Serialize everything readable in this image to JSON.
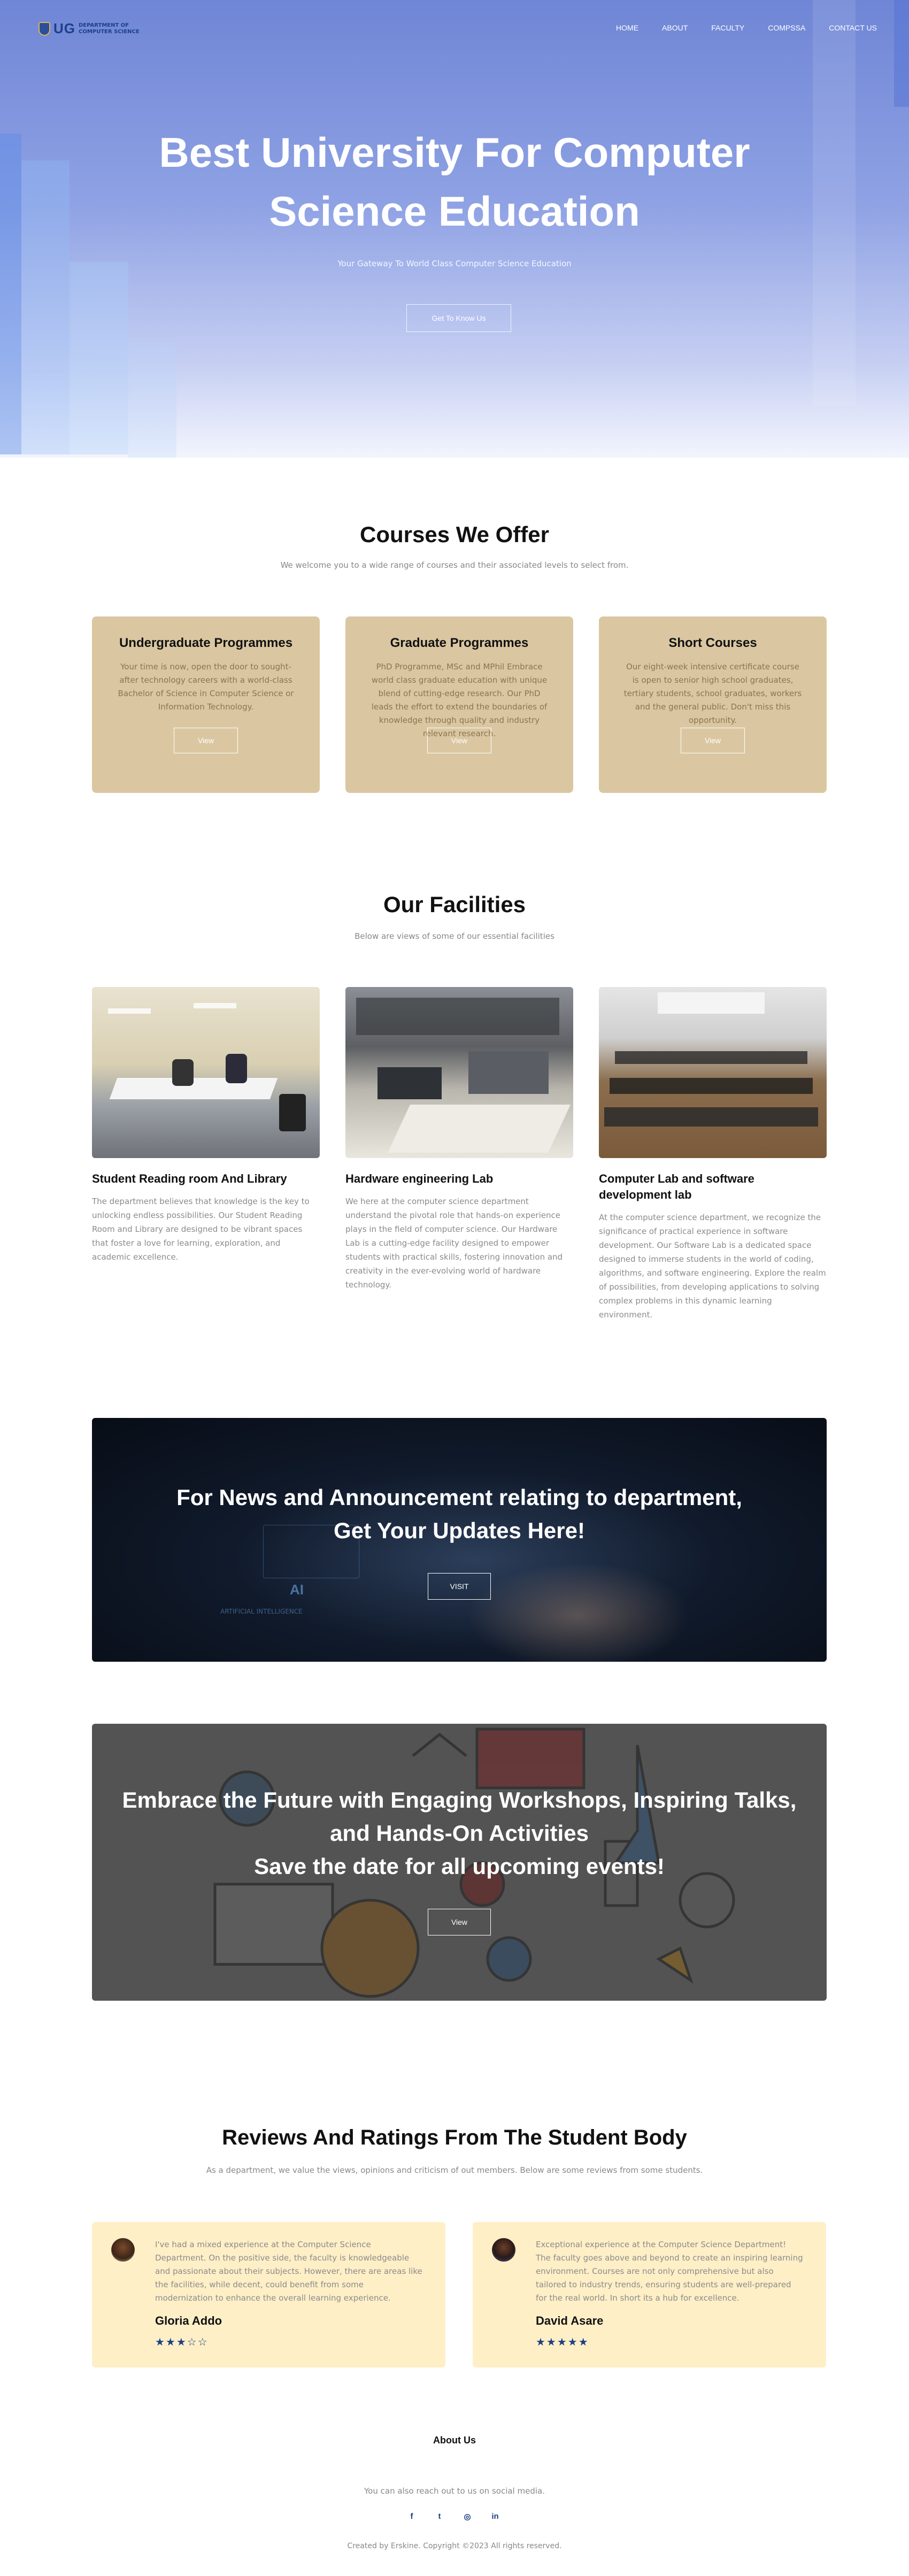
{
  "nav": {
    "logo_mark": "UG",
    "logo_line1": "DEPARTMENT OF",
    "logo_line2": "COMPUTER SCIENCE",
    "items": [
      "HOME",
      "ABOUT",
      "FACULTY",
      "COMPSSA",
      "CONTACT US"
    ]
  },
  "hero": {
    "title": "Best University For Computer Science Education",
    "subtitle": "Your Gateway To World Class Computer Science Education",
    "button": "Get To Know Us"
  },
  "courses": {
    "title": "Courses We Offer",
    "subtitle": "We welcome you to a wide range of courses and their associated levels to select from.",
    "items": [
      {
        "title": "Undergraduate Programmes",
        "text": "Your time is now, open the door to sought-after technology careers with a world-class Bachelor of Science in Computer Science or Information Technology.",
        "button": "View"
      },
      {
        "title": "Graduate Programmes",
        "text": "PhD Programme, MSc and MPhil Embrace world class graduate education with unique blend of cutting-edge research. Our PhD leads the effort to extend the boundaries of knowledge through quality and industry relevant research.",
        "button": "View"
      },
      {
        "title": "Short Courses",
        "text": "Our eight-week intensive certificate course is open to senior high school graduates, tertiary students, school graduates, workers and the general public. Don't miss this opportunity.",
        "button": "View"
      }
    ]
  },
  "facilities": {
    "title": "Our Facilities",
    "subtitle": "Below are views of some of our essential facilities",
    "items": [
      {
        "title": "Student Reading room And Library",
        "text": "The department believes that knowledge is the key to unlocking endless possibilities. Our Student Reading Room and Library are designed to be vibrant spaces that foster a love for learning, exploration, and academic excellence."
      },
      {
        "title": "Hardware engineering Lab",
        "text": "We here at the computer science department understand the pivotal role that hands-on experience plays in the field of computer science. Our Hardware Lab is a cutting-edge facility designed to empower students with practical skills, fostering innovation and creativity in the ever-evolving world of hardware technology."
      },
      {
        "title": "Computer Lab and software development lab",
        "text": "At the computer science department, we recognize the significance of practical experience in software development. Our Software Lab is a dedicated space designed to immerse students in the world of coding, algorithms, and software engineering. Explore the realm of possibilities, from developing applications to solving complex problems in this dynamic learning environment."
      }
    ]
  },
  "news": {
    "line1": "For News and Announcement relating to department,",
    "line2": "Get Your Updates Here!",
    "button": "VISIT",
    "bg_text1": "AI",
    "bg_text2": "ARTIFICIAL INTELLIGENCE"
  },
  "events": {
    "line1": "Embrace the Future with Engaging Workshops, Inspiring Talks,",
    "line2": "and Hands-On Activities",
    "line3": "Save the date for all upcoming events!",
    "button": "View"
  },
  "reviews": {
    "title": "Reviews And Ratings From The Student Body",
    "subtitle": "As a department, we value the views, opinions and criticism of out members. Below are some reviews from some students.",
    "items": [
      {
        "text": "I've had a mixed experience at the Computer Science Department. On the positive side, the faculty is knowledgeable and passionate about their subjects. However, there are areas like the facilities, while decent, could benefit from some modernization to enhance the overall learning experience.",
        "name": "Gloria Addo",
        "stars": "★★★☆☆",
        "rating": 3
      },
      {
        "text": "Exceptional experience at the Computer Science Department! The faculty goes above and beyond to create an inspiring learning environment. Courses are not only comprehensive but also tailored to industry trends, ensuring students are well-prepared for the real world. In short its a hub for excellence.",
        "name": "David Asare",
        "stars": "★★★★★",
        "rating": 5
      }
    ]
  },
  "footer": {
    "title": "About Us",
    "subtitle": "You can also reach out to us on social media.",
    "socials": [
      "f",
      "t",
      "◎",
      "in"
    ],
    "copyright": "Created by Erskine. Copyright ©2023 All rights reserved."
  },
  "colors": {
    "brand": "#1e3f86",
    "card": "#dac7a1",
    "review": "#feefc6"
  }
}
